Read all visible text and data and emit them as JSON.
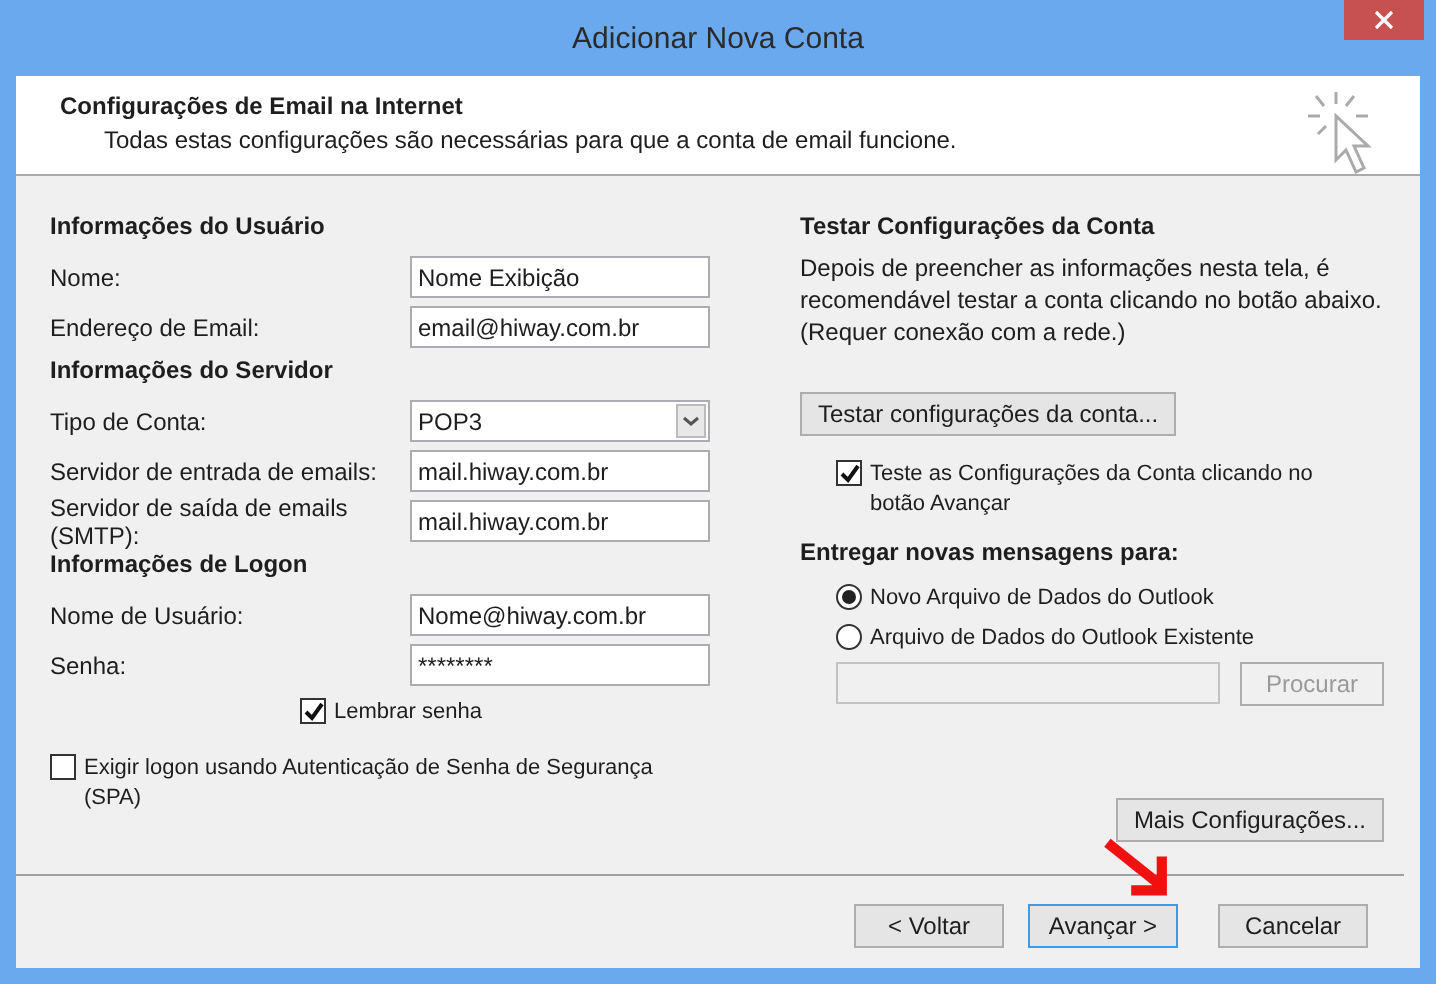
{
  "window": {
    "title": "Adicionar Nova Conta"
  },
  "header": {
    "title": "Configurações de Email na Internet",
    "subtitle": "Todas estas configurações são necessárias para que a conta de email funcione."
  },
  "sections": [
    {
      "heading": "Informações do Usuário",
      "fields": [
        {
          "kind": "text",
          "label": "Nome:",
          "value": "Nome Exibição"
        },
        {
          "kind": "text",
          "label": "Endereço de Email:",
          "value": "email@hiway.com.br"
        }
      ]
    },
    {
      "heading": "Informações do Servidor",
      "fields": [
        {
          "kind": "select",
          "label": "Tipo de Conta:",
          "value": "POP3"
        },
        {
          "kind": "text",
          "label": "Servidor de entrada de emails:",
          "value": "mail.hiway.com.br"
        },
        {
          "kind": "text",
          "label": "Servidor de saída de emails (SMTP):",
          "value": "mail.hiway.com.br"
        }
      ]
    },
    {
      "heading": "Informações de Logon",
      "fields": [
        {
          "kind": "text",
          "label": "Nome de Usuário:",
          "value": "Nome@hiway.com.br"
        },
        {
          "kind": "password",
          "label": "Senha:",
          "value": "********"
        }
      ]
    }
  ],
  "remember": {
    "label": "Lembrar senha",
    "checked": true
  },
  "spa": {
    "label": "Exigir logon usando Autenticação de Senha de Segurança (SPA)",
    "checked": false
  },
  "test": {
    "heading": "Testar Configurações da Conta",
    "description": "Depois de preencher as informações nesta tela, é recomendável testar a conta clicando no botão abaixo. (Requer conexão com a rede.)",
    "button": "Testar configurações da conta...",
    "checkbox": {
      "label": "Teste as Configurações da Conta clicando no botão Avançar",
      "checked": true
    }
  },
  "deliver": {
    "heading": "Entregar novas mensagens para:",
    "options": [
      {
        "label": "Novo Arquivo de Dados do Outlook",
        "selected": true
      },
      {
        "label": "Arquivo de Dados do Outlook Existente",
        "selected": false
      }
    ],
    "browse": {
      "label": "Procurar",
      "disabled": true
    }
  },
  "more_button": "Mais Configurações...",
  "footer_buttons": [
    {
      "label": "< Voltar",
      "default": false
    },
    {
      "label": "Avançar >",
      "default": true
    },
    {
      "label": "Cancelar",
      "default": false
    }
  ]
}
